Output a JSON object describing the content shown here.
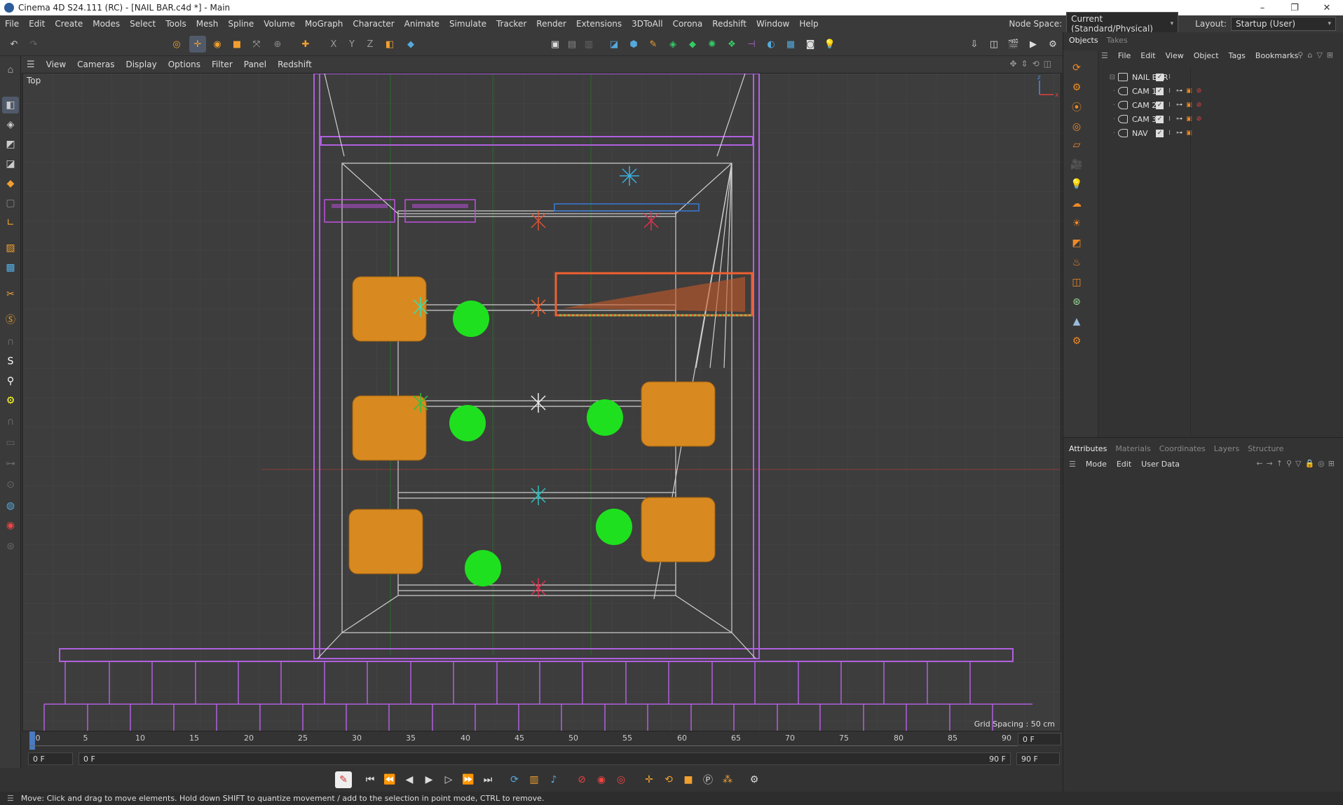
{
  "window": {
    "title": "Cinema 4D S24.111 (RC) - [NAIL BAR.c4d *] - Main",
    "controls": [
      "–",
      "❐",
      "✕"
    ]
  },
  "menubar": {
    "items": [
      "File",
      "Edit",
      "Create",
      "Modes",
      "Select",
      "Tools",
      "Mesh",
      "Spline",
      "Volume",
      "MoGraph",
      "Character",
      "Animate",
      "Simulate",
      "Tracker",
      "Render",
      "Extensions",
      "3DToAll",
      "Corona",
      "Redshift",
      "Window",
      "Help"
    ],
    "node_space_label": "Node Space:",
    "node_space_value": "Current (Standard/Physical)",
    "layout_label": "Layout:",
    "layout_value": "Startup (User)"
  },
  "viewport": {
    "menu": [
      "View",
      "Cameras",
      "Display",
      "Options",
      "Filter",
      "Panel",
      "Redshift"
    ],
    "view_name": "Top",
    "grid_spacing": "Grid Spacing : 50 cm"
  },
  "timeline": {
    "ticks": [
      "0",
      "5",
      "10",
      "15",
      "20",
      "25",
      "30",
      "35",
      "40",
      "45",
      "50",
      "55",
      "60",
      "65",
      "70",
      "75",
      "80",
      "85",
      "90"
    ],
    "current_frame_right": "0 F",
    "start_field": "0 F",
    "range_start": "0 F",
    "range_end": "90 F",
    "end_field": "90 F"
  },
  "objects_panel": {
    "tabs": [
      "Objects",
      "Takes"
    ],
    "menu": [
      "File",
      "Edit",
      "View",
      "Object",
      "Tags",
      "Bookmarks"
    ],
    "objects": [
      {
        "name": "NAIL BAR",
        "tree": "⊟"
      },
      {
        "name": "CAM 1",
        "tree": "·"
      },
      {
        "name": "CAM 2",
        "tree": "·"
      },
      {
        "name": "CAM 3",
        "tree": "·"
      },
      {
        "name": "NAV",
        "tree": "·"
      }
    ]
  },
  "attributes_panel": {
    "tabs": [
      "Attributes",
      "Materials",
      "Coordinates",
      "Layers",
      "Structure"
    ],
    "menu": [
      "Mode",
      "Edit",
      "User Data"
    ]
  },
  "status": {
    "message": "Move: Click and drag to move elements. Hold down SHIFT to quantize movement / add to the selection in point mode, CTRL to remove."
  },
  "colors": {
    "accent_orange": "#f08a24",
    "selection_blue": "#505a6a",
    "green_marker": "#1fe01f"
  }
}
